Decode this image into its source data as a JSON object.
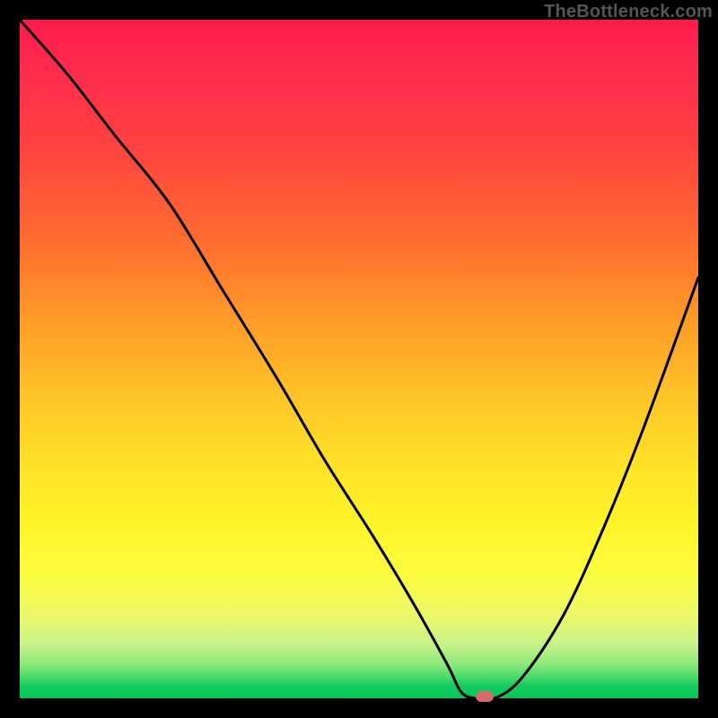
{
  "watermark": "TheBottleneck.com",
  "chart_data": {
    "type": "line",
    "title": "",
    "xlabel": "",
    "ylabel": "",
    "xlim": [
      0,
      100
    ],
    "ylim": [
      0,
      100
    ],
    "grid": false,
    "legend": false,
    "background": "rainbow-gradient (red top → green bottom)",
    "series": [
      {
        "name": "bottleneck-curve",
        "color": "#000000",
        "x": [
          0,
          7,
          14,
          22,
          30,
          38,
          45,
          52,
          58,
          63,
          65,
          67,
          70,
          74,
          80,
          86,
          92,
          100
        ],
        "y": [
          100,
          92,
          83,
          73,
          60,
          47,
          35,
          24,
          14,
          5,
          1,
          0,
          0,
          3,
          12,
          25,
          40,
          62
        ]
      }
    ],
    "marker": {
      "x": 68.5,
      "y": 0,
      "color": "#d86a6a",
      "shape": "pill"
    }
  }
}
